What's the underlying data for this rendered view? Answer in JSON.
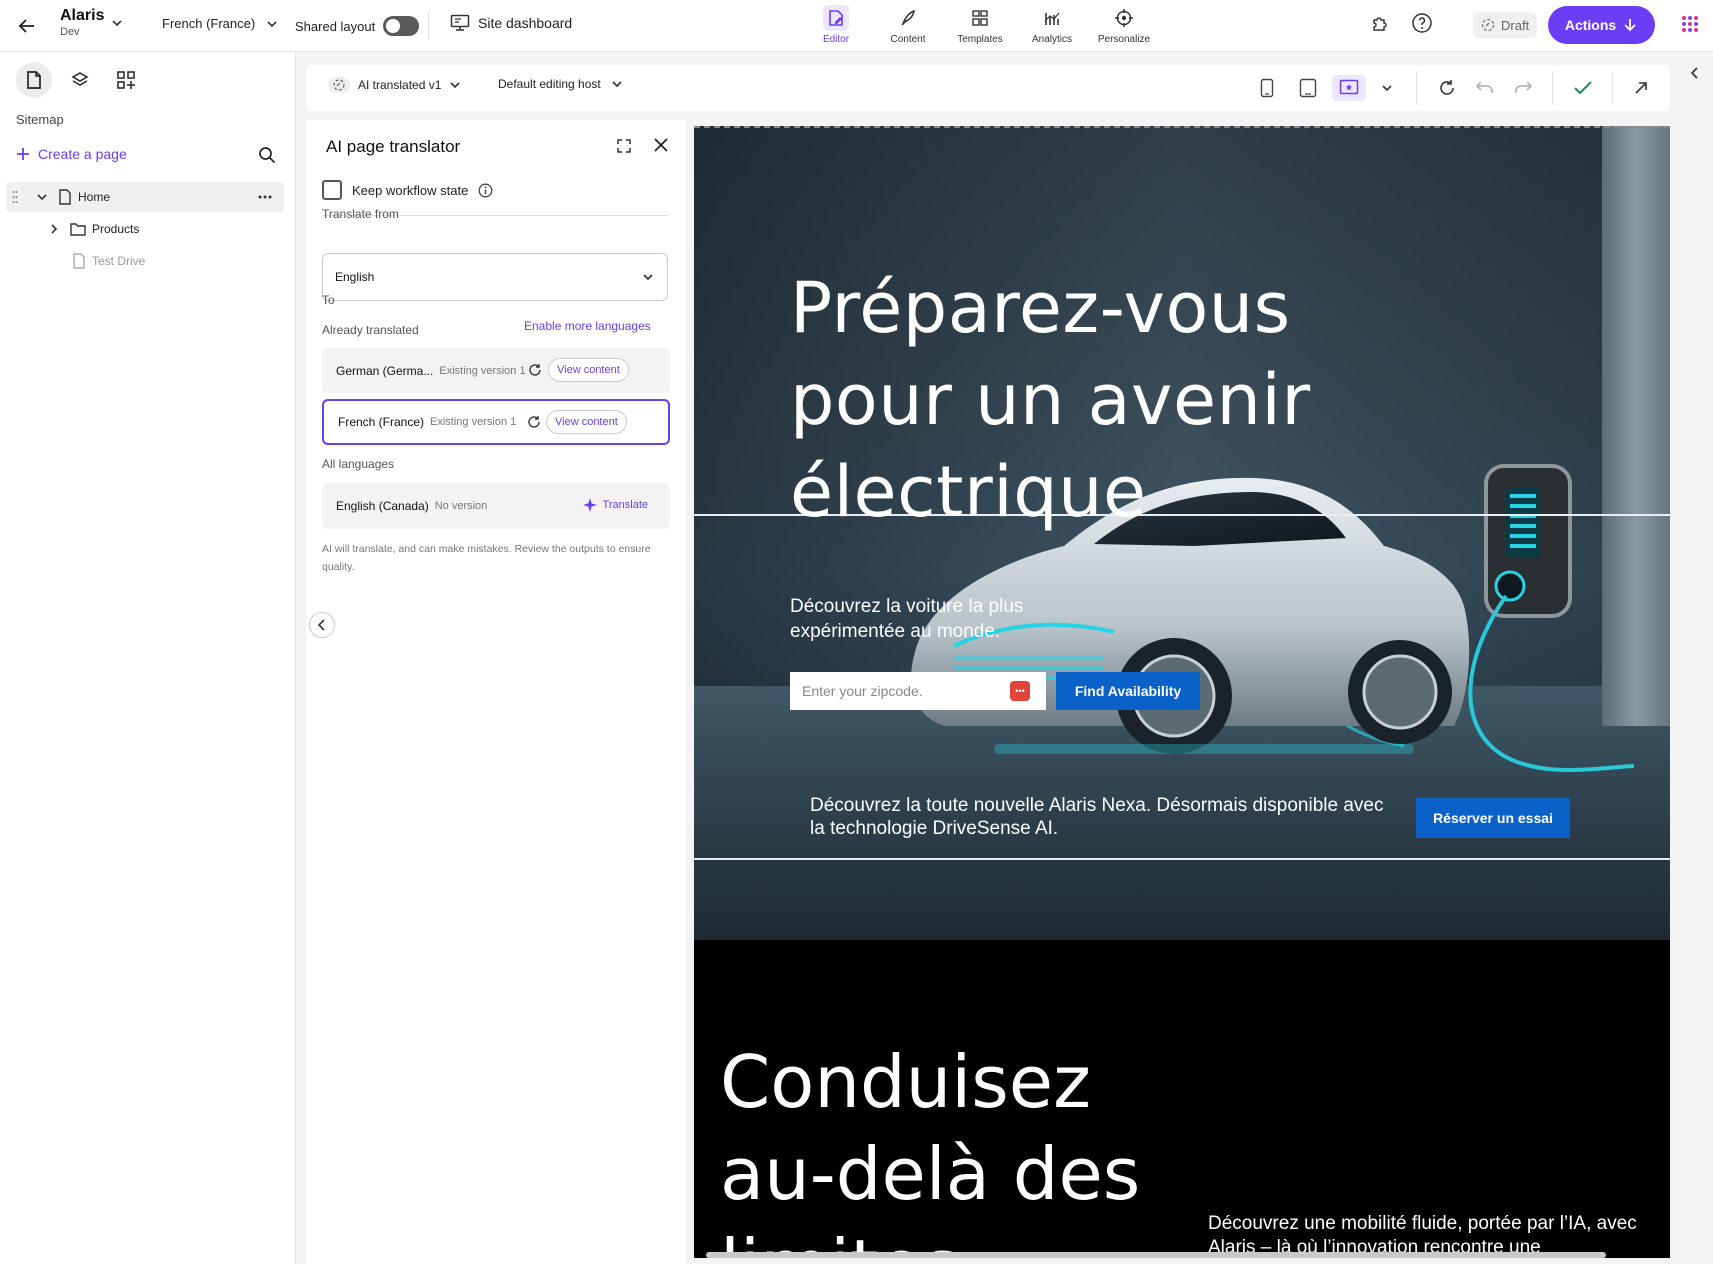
{
  "app": {
    "name": "Alaris",
    "env": "Dev"
  },
  "topbar": {
    "language": "French (France)",
    "shared_layout": "Shared layout",
    "site_dashboard": "Site dashboard",
    "nav": [
      {
        "label": "Editor",
        "icon": "editor-icon",
        "active": true
      },
      {
        "label": "Content",
        "icon": "feather-icon"
      },
      {
        "label": "Templates",
        "icon": "templates-icon"
      },
      {
        "label": "Analytics",
        "icon": "analytics-icon"
      },
      {
        "label": "Personalize",
        "icon": "personalize-icon"
      }
    ],
    "draft": "Draft",
    "actions": "Actions",
    "accent": "#6b3df5"
  },
  "sidebar": {
    "title": "Sitemap",
    "create": "Create a page",
    "tree": [
      {
        "label": "Home"
      },
      {
        "label": "Products"
      },
      {
        "label": "Test Drive"
      }
    ]
  },
  "canvasbar": {
    "version": "AI translated v1",
    "host": "Default editing host"
  },
  "translator": {
    "title": "AI page translator",
    "keep_workflow": "Keep workflow state",
    "translate_from": "Translate from",
    "from_value": "English",
    "to": "To",
    "enable_more": "Enable more languages",
    "already_translated": "Already translated",
    "translated": [
      {
        "lang": "German (Germa...",
        "status": "Existing version 1",
        "action": "View content"
      },
      {
        "lang": "French (France)",
        "status": "Existing version 1",
        "action": "View content"
      }
    ],
    "all_languages": "All languages",
    "others": [
      {
        "lang": "English (Canada)",
        "status": "No version",
        "action": "Translate"
      }
    ],
    "note": "AI will translate, and can make mistakes. Review the outputs to ensure quality."
  },
  "preview": {
    "hero_title": "Préparez-vous pour un avenir électrique",
    "hero_sub": "Découvrez la voiture la plus expérimentée au monde.",
    "zip_placeholder": "Enter your zipcode.",
    "find_button": "Find Availability",
    "promo": "Découvrez la toute nouvelle Alaris Nexa. Désormais disponible avec la technologie DriveSense AI.",
    "reserve_button": "Réserver un essai",
    "section2_title": "Conduisez au-delà des limites",
    "section2_text": "Découvrez une mobilité fluide, portée par l’IA, avec Alaris – là où l’innovation rencontre une"
  }
}
